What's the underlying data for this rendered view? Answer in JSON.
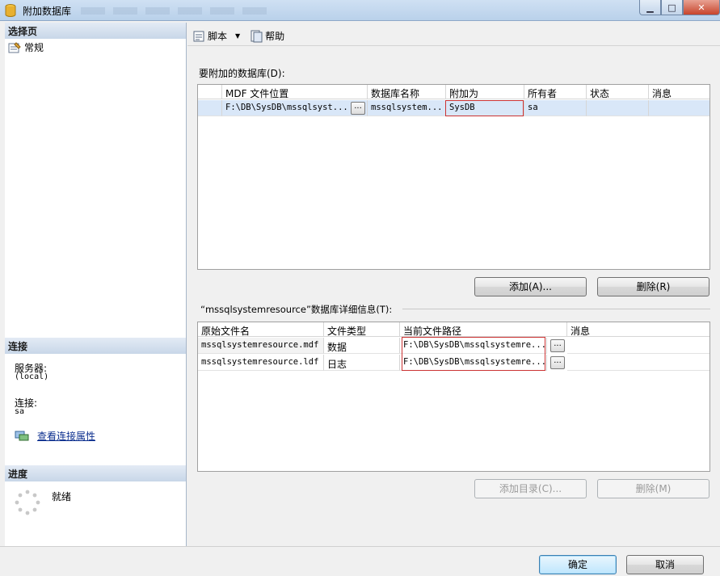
{
  "window": {
    "title": "附加数据库"
  },
  "left": {
    "select_page_header": "选择页",
    "nav_general": "常规",
    "connection_header": "连接",
    "server_label": "服务器:",
    "server_value": "(local)",
    "connection_label": "连接:",
    "connection_value": "sa",
    "view_props_link": "查看连接属性",
    "progress_header": "进度",
    "progress_status": "就绪"
  },
  "toolbar": {
    "script_label": "脚本",
    "help_label": "帮助"
  },
  "attach": {
    "section_label": "要附加的数据库(D):",
    "columns": [
      "MDF 文件位置",
      "数据库名称",
      "附加为",
      "所有者",
      "状态",
      "消息"
    ],
    "rows": [
      {
        "mdf": "F:\\DB\\SysDB\\mssqlsyst...",
        "db_name": "mssqlsystem...",
        "attach_as": "SysDB",
        "owner": "sa",
        "status": "",
        "message": ""
      }
    ],
    "add_button": "添加(A)...",
    "remove_button": "删除(R)"
  },
  "details": {
    "section_label": "“mssqlsystemresource”数据库详细信息(T):",
    "columns": [
      "原始文件名",
      "文件类型",
      "当前文件路径",
      "消息"
    ],
    "rows": [
      {
        "file": "mssqlsystemresource.mdf",
        "type": "数据",
        "path": "F:\\DB\\SysDB\\mssqlsystemre...",
        "message": ""
      },
      {
        "file": "mssqlsystemresource.ldf",
        "type": "日志",
        "path": "F:\\DB\\SysDB\\mssqlsystemre...",
        "message": ""
      }
    ],
    "add_catalog_button": "添加目录(C)...",
    "remove_button": "删除(M)"
  },
  "footer": {
    "ok_button": "确定",
    "cancel_button": "取消"
  },
  "icons": {
    "app": "database-icon",
    "general": "properties-icon",
    "script": "script-icon",
    "help": "help-icon",
    "connection": "connection-properties-icon",
    "progress": "spinner-icon"
  }
}
